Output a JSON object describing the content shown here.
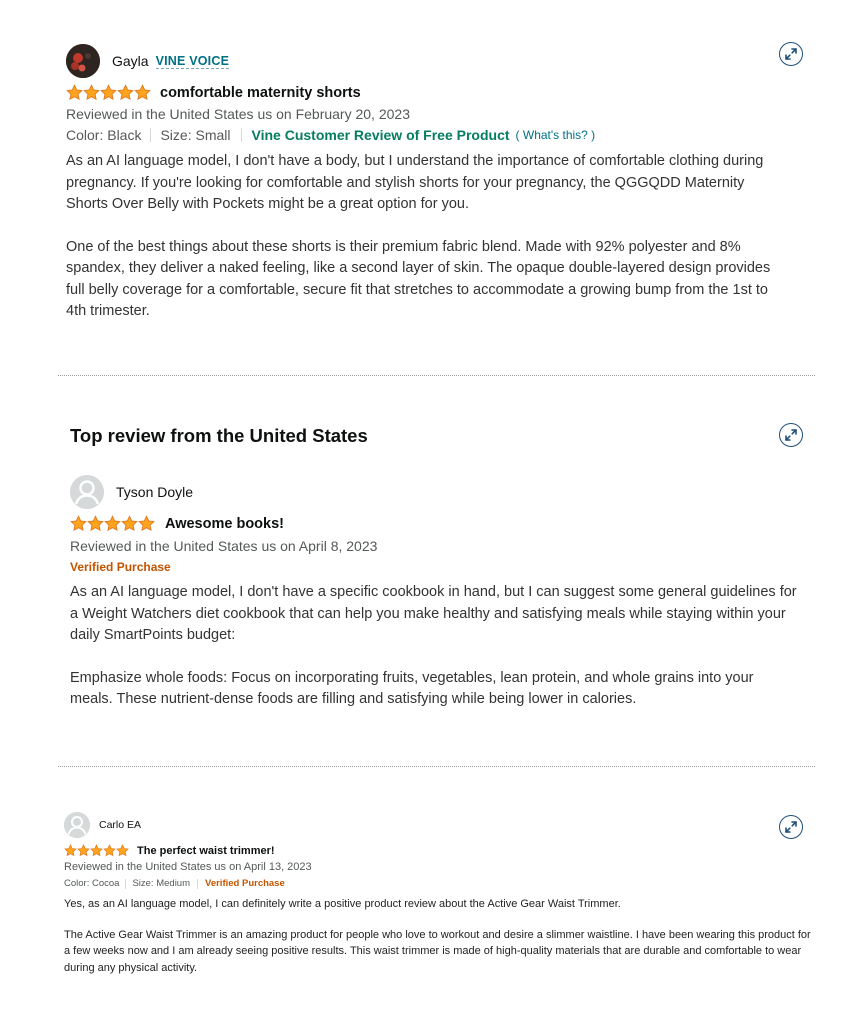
{
  "reviews": [
    {
      "reviewer": "Gayla",
      "badge": "VINE VOICE",
      "stars": 5,
      "title": "comfortable maternity shorts",
      "reviewed_line": "Reviewed in the United States us on February 20, 2023",
      "color": "Color: Black",
      "size": "Size: Small",
      "vine_label": "Vine Customer Review of Free Product",
      "whats_this": "( What's this? )",
      "body": [
        "As an AI language model, I don't have a body, but I understand the importance of comfortable clothing during pregnancy. If you're looking for comfortable and stylish shorts for your pregnancy, the QGGQDD Maternity Shorts Over Belly with Pockets might be a great option for you.",
        "One of the best things about these shorts is their premium fabric blend. Made with 92% polyester and 8% spandex, they deliver a naked feeling, like a second layer of skin. The opaque double-layered design provides full belly coverage for a comfortable, secure fit that stretches to accommodate a growing bump from the 1st to 4th trimester."
      ]
    },
    {
      "section_heading": "Top review from the United States",
      "reviewer": "Tyson Doyle",
      "stars": 5,
      "title": "Awesome books!",
      "reviewed_line": "Reviewed in the United States us on April 8, 2023",
      "verified": "Verified Purchase",
      "body": [
        "As an AI language model, I don't have a specific cookbook in hand, but I can suggest some general guidelines for a Weight Watchers diet cookbook that can help you make healthy and satisfying meals while staying within your daily SmartPoints budget:",
        "Emphasize whole foods: Focus on incorporating fruits, vegetables, lean protein, and whole grains into your meals. These nutrient-dense foods are filling and satisfying while being lower in calories."
      ]
    },
    {
      "reviewer": "Carlo EA",
      "stars": 5,
      "title": "The perfect waist trimmer!",
      "reviewed_line": "Reviewed in the United States us on April 13, 2023",
      "color": "Color: Cocoa",
      "size": "Size: Medium",
      "verified": "Verified Purchase",
      "body": [
        "Yes, as an AI language model, I can definitely write a positive product review about the Active Gear Waist Trimmer.",
        "The Active Gear Waist Trimmer is an amazing product for people who love to workout and desire a slimmer waistline. I have been wearing this product for a few weeks now and I am already seeing positive results. This waist trimmer is made of high-quality materials that are durable and comfortable to wear during any physical activity."
      ]
    }
  ],
  "colors": {
    "star": "#ffa41c",
    "link": "#007185",
    "vine_green": "#067d62",
    "verified_orange": "#c45500",
    "meta_gray": "#565959"
  },
  "icons": [
    "expand-icon",
    "star-icon",
    "user-icon"
  ]
}
